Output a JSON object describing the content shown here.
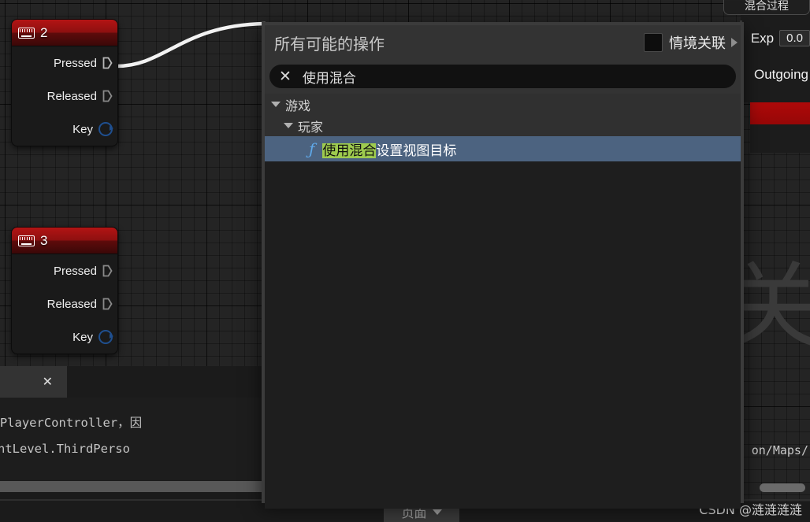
{
  "graph": {
    "watermark_char": "关",
    "nodes": [
      {
        "title": "2",
        "icon": "keyboard-icon",
        "pins": [
          {
            "label": "Pressed",
            "type": "exec"
          },
          {
            "label": "Released",
            "type": "exec"
          },
          {
            "label": "Key",
            "type": "data"
          }
        ]
      },
      {
        "title": "3",
        "icon": "keyboard-icon",
        "pins": [
          {
            "label": "Pressed",
            "type": "exec"
          },
          {
            "label": "Released",
            "type": "exec"
          },
          {
            "label": "Key",
            "type": "data"
          }
        ]
      }
    ]
  },
  "right_panel": {
    "clipped_top_label": "混合过程",
    "exp_label": "Exp",
    "exp_value": "0.0",
    "outgoing_label": "Outgoing",
    "path_text": "on/Maps/"
  },
  "log_panel": {
    "tab_close": "✕",
    "lines": [
      "身）并非是一个 PlayerController，因",
      "编译 PersistentLevel.ThirdPerso"
    ]
  },
  "action_menu": {
    "title": "所有可能的操作",
    "context_label": "情境关联",
    "context_checked": false,
    "expand_icon": "chevron-right-icon",
    "search": {
      "clear_icon": "✕",
      "value": "使用混合",
      "placeholder": ""
    },
    "tree": [
      {
        "label": "游戏",
        "level": 0,
        "expanded": true
      },
      {
        "label": "玩家",
        "level": 1,
        "expanded": true
      }
    ],
    "selected_item": {
      "icon": "function-icon",
      "highlight": "使用混合",
      "rest": "设置视图目标"
    }
  },
  "bottom_bar": {
    "page_button_label": "页面",
    "page_button_icon": "chevron-down-icon",
    "watermark": "CSDN @涟涟涟涟"
  },
  "colors": {
    "node_header_red": "#b31414",
    "selection_blue": "#4c6380",
    "highlight_green": "#9ecb4e",
    "function_icon_blue": "#5fa8e8",
    "panel_border": "#3b3b3b"
  }
}
